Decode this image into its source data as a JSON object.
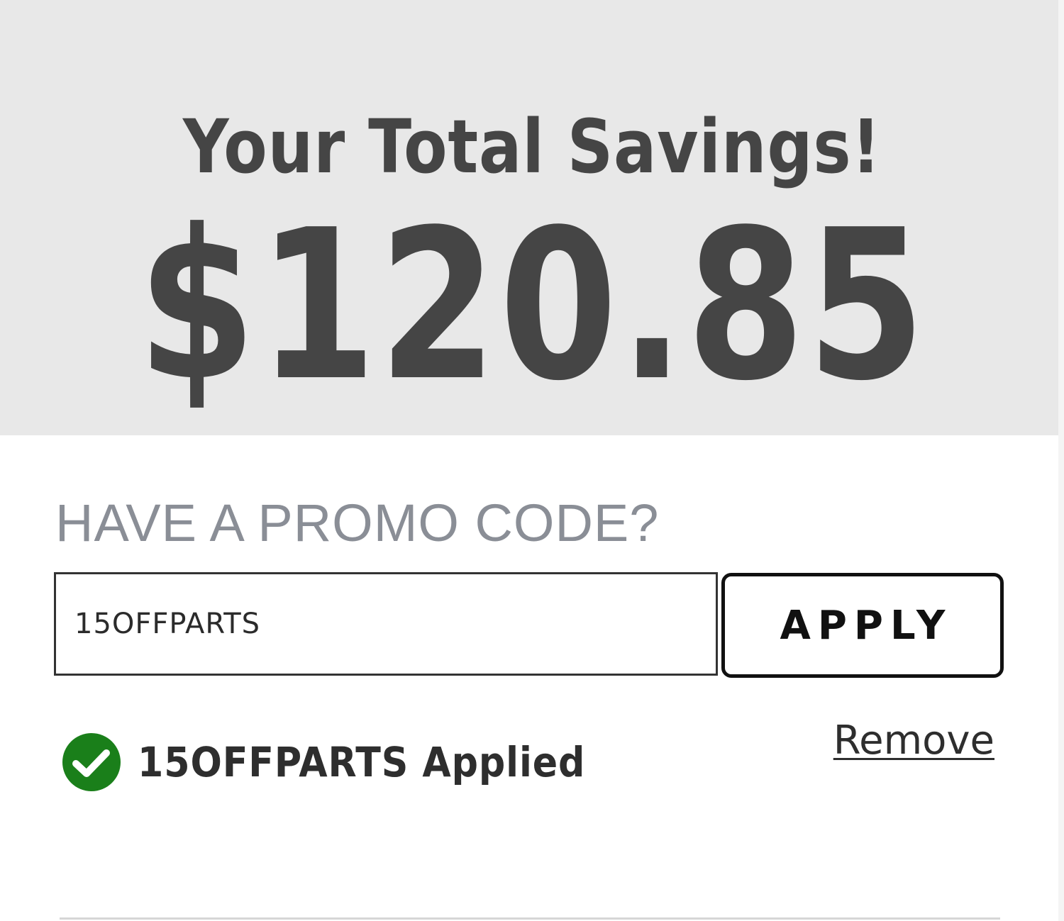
{
  "savings": {
    "title": "Your Total Savings!",
    "amount": "$120.85"
  },
  "promo": {
    "heading": "HAVE A PROMO CODE?",
    "input_value": "15OFFPARTS",
    "apply_label": "APPLY",
    "applied_text": "15OFFPARTS Applied",
    "remove_label": "Remove",
    "status_icon": "check-circle-icon",
    "status_color": "#1a7f1a"
  },
  "colors": {
    "panel_background": "#e8e8e8",
    "heading_gray": "#8a8e96",
    "text_dark": "#454545"
  }
}
